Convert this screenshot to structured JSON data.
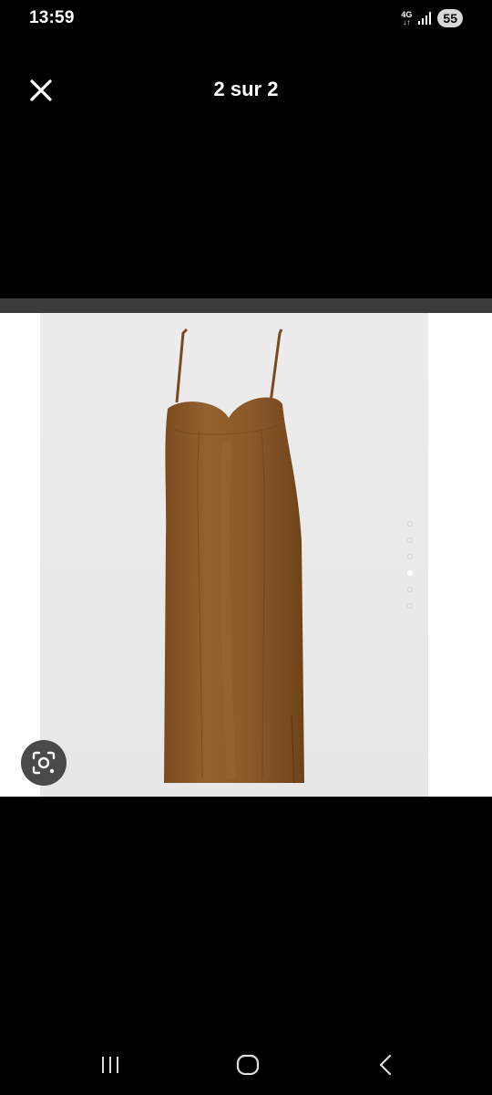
{
  "status_bar": {
    "time": "13:59",
    "network_type": "4G",
    "network_arrows": "↓↑",
    "battery": "55"
  },
  "header": {
    "title": "2 sur 2",
    "close_icon": "close-icon"
  },
  "gallery": {
    "dot_count": 6,
    "active_dot_index": 3,
    "dress_color": "#8b5a2b",
    "background_color": "#e9e9e9"
  },
  "actions": {
    "lens_icon": "image-search-lens-icon"
  },
  "nav": {
    "recents_icon": "recents-icon",
    "home_icon": "home-icon",
    "back_icon": "back-icon"
  }
}
